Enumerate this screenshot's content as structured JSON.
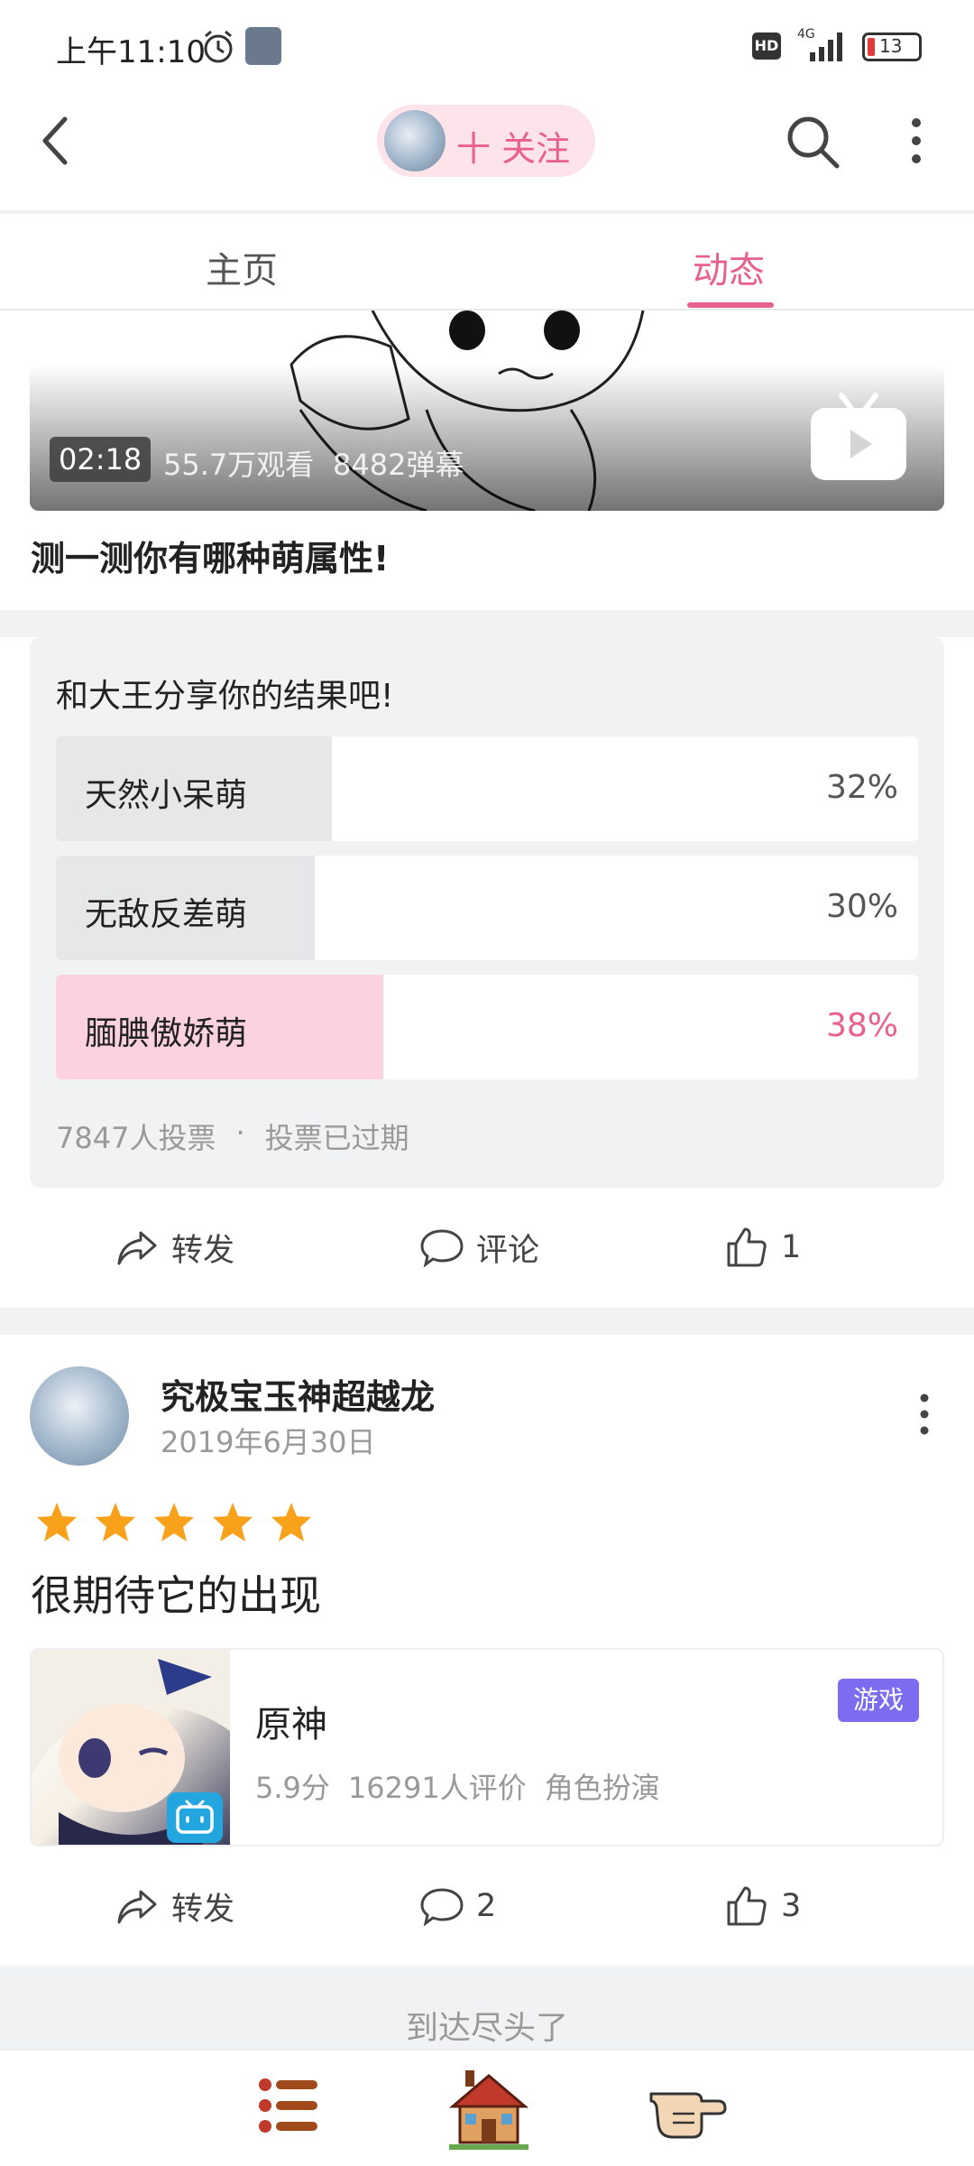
{
  "status_bar": {
    "time": "上午11:10",
    "battery": "13",
    "network": "4G"
  },
  "top_bar": {
    "follow_label": "十 关注"
  },
  "tabs": [
    {
      "label": "主页",
      "active": false
    },
    {
      "label": "动态",
      "active": true
    }
  ],
  "video_post": {
    "duration": "02:18",
    "views": "55.7万观看",
    "danmaku": "8482弹幕",
    "title": "测一测你有哪种萌属性!"
  },
  "poll": {
    "prompt": "和大王分享你的结果吧!",
    "options": [
      {
        "label": "天然小呆萌",
        "percent_text": "32%",
        "percent": 32,
        "selected": false
      },
      {
        "label": "无敌反差萌",
        "percent_text": "30%",
        "percent": 30,
        "selected": false
      },
      {
        "label": "腼腆傲娇萌",
        "percent_text": "38%",
        "percent": 38,
        "selected": true
      }
    ],
    "votes": "7847人投票",
    "separator": "·",
    "status": "投票已过期"
  },
  "post1_actions": {
    "share": "转发",
    "comment": "评论",
    "like": "1"
  },
  "review_post": {
    "author": "究极宝玉神超越龙",
    "date": "2019年6月30日",
    "rating_stars": 5,
    "text": "很期待它的出现",
    "game": {
      "name": "原神",
      "badge": "游戏",
      "score": "5.9分",
      "reviews": "16291人评价",
      "genre": "角色扮演"
    },
    "actions": {
      "share": "转发",
      "comment": "2",
      "like": "3"
    }
  },
  "end_text": "到达尽头了",
  "colors": {
    "accent_pink": "#e8618c",
    "pink_light": "#fcd2df",
    "badge_purple": "#7b6cf0",
    "star": "#f8a21c"
  }
}
